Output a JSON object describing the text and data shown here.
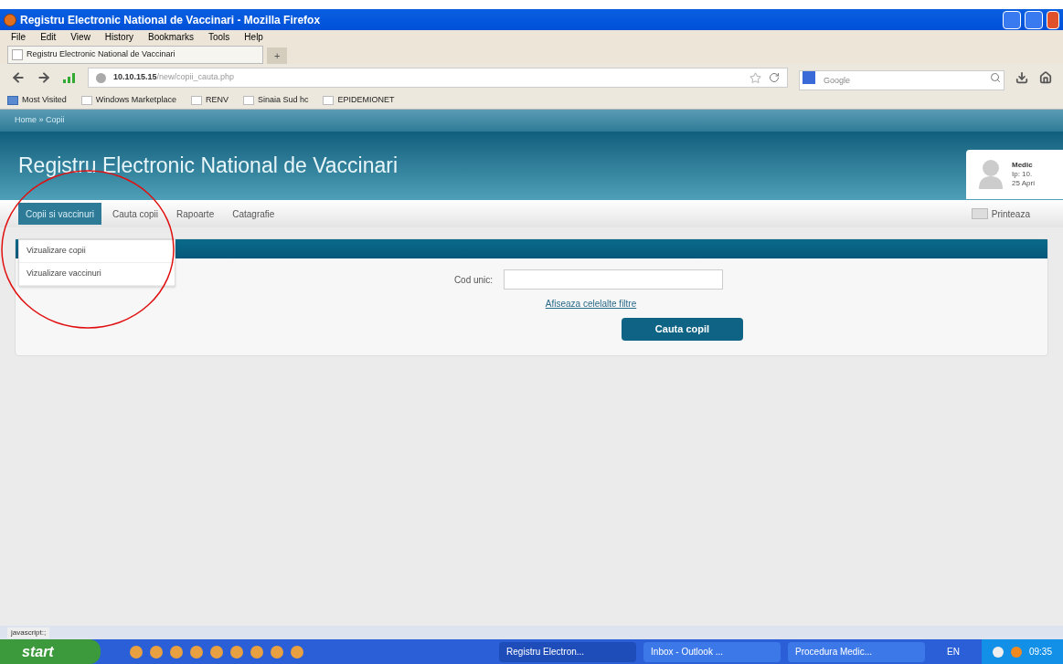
{
  "window": {
    "title": "Registru Electronic National de Vaccinari - Mozilla Firefox"
  },
  "menu": [
    "File",
    "Edit",
    "View",
    "History",
    "Bookmarks",
    "Tools",
    "Help"
  ],
  "tabs": [
    {
      "label": "Registru Electronic National de Vaccinari",
      "selected": true
    }
  ],
  "new_tab": "+",
  "address": {
    "host": "10.10.15.15",
    "path": "/new/copii_cauta.php"
  },
  "search": {
    "placeholder": "Google"
  },
  "bookmarks": [
    "Most Visited",
    "Windows Marketplace",
    "RENV",
    "Sinaia Sud hc",
    "EPIDEMIONET"
  ],
  "breadcrumb": "Home » Copii",
  "site": {
    "title": "Registru Electronic National de Vaccinari"
  },
  "user": {
    "name": "Medic",
    "line_2": "Ip: 10.",
    "line_3": "25 Apri"
  },
  "nav": [
    {
      "label": "Copii si vaccinuri",
      "selected": true
    },
    {
      "label": "Cauta copii",
      "selected": false
    },
    {
      "label": "Rapoarte",
      "selected": false
    },
    {
      "label": "Catagrafie",
      "selected": false
    }
  ],
  "print": "Printeaza",
  "dropdown": [
    "Vizualizare copii",
    "Vizualizare vaccinuri"
  ],
  "form": {
    "label": "Cod unic:",
    "link": "Afiseaza celelalte filtre",
    "button": "Cauta copil"
  },
  "status_bar": "javascript:;",
  "taskbar": {
    "start": "start",
    "tasks": [
      "Registru Electron...",
      "Inbox - Outlook ...",
      "Procedura Medic..."
    ],
    "lang": "EN",
    "time": "09:35"
  }
}
